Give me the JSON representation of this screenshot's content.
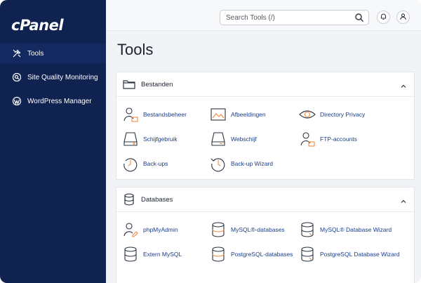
{
  "brand": {
    "logo_text": "cPanel"
  },
  "sidebar": {
    "items": [
      {
        "label": "Tools",
        "icon": "tools-icon"
      },
      {
        "label": "Site Quality Monitoring",
        "icon": "site-quality-icon"
      },
      {
        "label": "WordPress Manager",
        "icon": "wordpress-icon"
      }
    ]
  },
  "topbar": {
    "search_placeholder": "Search Tools (/)",
    "notifications_icon": "bell-icon",
    "user_icon": "user-icon"
  },
  "page": {
    "title": "Tools"
  },
  "sections": [
    {
      "title": "Bestanden",
      "icon": "folder-icon",
      "tools": [
        {
          "label": "Bestandsbeheer",
          "icon": "file-manager-icon"
        },
        {
          "label": "Afbeeldingen",
          "icon": "images-icon"
        },
        {
          "label": "Directory Privacy",
          "icon": "directory-privacy-icon"
        },
        {
          "label": "Schijfgebruik",
          "icon": "disk-usage-icon"
        },
        {
          "label": "Webschijf",
          "icon": "web-disk-icon"
        },
        {
          "label": "FTP-accounts",
          "icon": "ftp-accounts-icon"
        },
        {
          "label": "Back-ups",
          "icon": "backups-icon"
        },
        {
          "label": "Back-up Wizard",
          "icon": "backup-wizard-icon"
        }
      ]
    },
    {
      "title": "Databases",
      "icon": "database-icon",
      "tools": [
        {
          "label": "phpMyAdmin",
          "icon": "phpmyadmin-icon"
        },
        {
          "label": "MySQL®-databases",
          "icon": "mysql-databases-icon"
        },
        {
          "label": "MySQL® Database Wizard",
          "icon": "mysql-wizard-icon"
        },
        {
          "label": "Extern MySQL",
          "icon": "remote-mysql-icon"
        },
        {
          "label": "PostgreSQL-databases",
          "icon": "postgresql-databases-icon"
        },
        {
          "label": "PostgreSQL Database Wizard",
          "icon": "postgresql-wizard-icon"
        }
      ]
    }
  ],
  "colors": {
    "sidebar_bg": "#0f2250",
    "accent_orange": "#f28a3c",
    "link_blue": "#1a3e8c",
    "icon_stroke": "#2b3340"
  }
}
